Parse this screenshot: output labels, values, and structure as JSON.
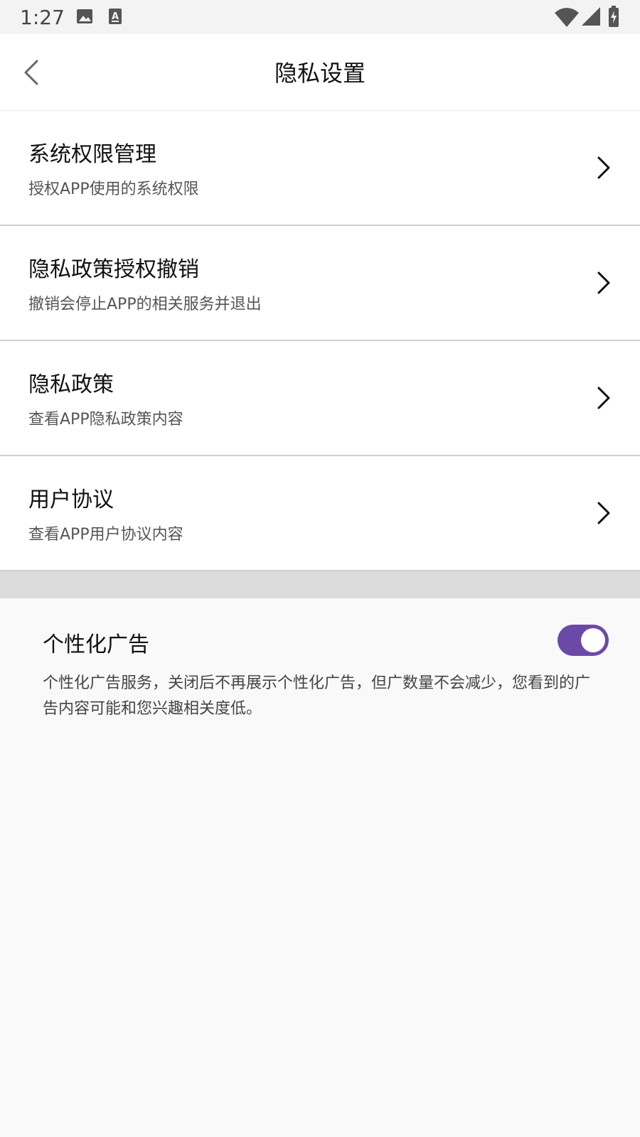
{
  "status_bar": {
    "time": "1:27",
    "icons": [
      "image-icon",
      "text-a-icon",
      "wifi-icon",
      "signal-icon",
      "battery-charging-icon"
    ]
  },
  "header": {
    "title": "隐私设置",
    "back_icon": "chevron-left-icon"
  },
  "list": {
    "items": [
      {
        "title": "系统权限管理",
        "subtitle": "授权APP使用的系统权限"
      },
      {
        "title": "隐私政策授权撤销",
        "subtitle": "撤销会停止APP的相关服务并退出"
      },
      {
        "title": "隐私政策",
        "subtitle": "查看APP隐私政策内容"
      },
      {
        "title": "用户协议",
        "subtitle": "查看APP用户协议内容"
      }
    ]
  },
  "ads": {
    "title": "个性化广告",
    "enabled": true,
    "description": "个性化广告服务，关闭后不再展示个性化广告，但广数量不会减少，您看到的广告内容可能和您兴趣相关度低。",
    "toggle_color": "#6a4aa6"
  }
}
